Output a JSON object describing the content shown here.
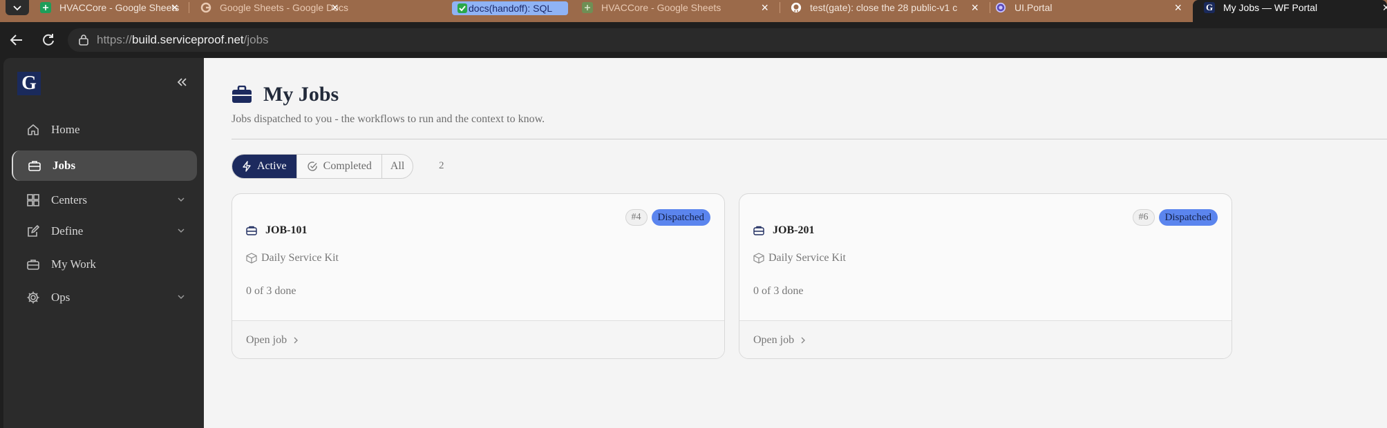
{
  "browser": {
    "tabs": [
      {
        "label": "HVACCore - Google Sheets",
        "favicon": "sheets-icon"
      },
      {
        "label": "Google Sheets - Google Docs Edit",
        "favicon": "google-icon"
      },
      {
        "label": "docs(handoff): SQL",
        "favicon": "checkmark-icon"
      },
      {
        "label": "HVACCore - Google Sheets",
        "favicon": "sheets-icon"
      },
      {
        "label": "test(gate): close the 28 public-v1 c",
        "favicon": "github-icon"
      },
      {
        "label": "UI.Portal",
        "favicon": "portal-icon"
      },
      {
        "label": "My Jobs — WF Portal",
        "favicon": "g-logo-icon"
      }
    ],
    "url": {
      "scheme": "https://",
      "host": "build.serviceproof.net",
      "path": "/jobs"
    }
  },
  "sidebar": {
    "logo_letter": "G",
    "items": [
      {
        "label": "Home",
        "icon": "home-icon"
      },
      {
        "label": "Jobs",
        "icon": "briefcase-icon",
        "active": true
      },
      {
        "label": "Centers",
        "icon": "grid-icon",
        "expandable": true
      },
      {
        "label": "Define",
        "icon": "edit-icon",
        "expandable": true
      },
      {
        "label": "My Work",
        "icon": "briefcase-icon"
      },
      {
        "label": "Ops",
        "icon": "gear-icon",
        "expandable": true
      }
    ]
  },
  "page": {
    "title": "My Jobs",
    "subtitle": "Jobs dispatched to you - the workflows to run and the context to know.",
    "filters": [
      {
        "label": "Active",
        "icon": "lightning-icon",
        "selected": true
      },
      {
        "label": "Completed",
        "icon": "check-circle-icon"
      },
      {
        "label": "All"
      }
    ],
    "count": "2"
  },
  "jobs": [
    {
      "number": "#4",
      "status": "Dispatched",
      "id": "JOB-101",
      "kit": "Daily Service Kit",
      "progress": "0 of 3 done",
      "open_label": "Open job"
    },
    {
      "number": "#6",
      "status": "Dispatched",
      "id": "JOB-201",
      "kit": "Daily Service Kit",
      "progress": "0 of 3 done",
      "open_label": "Open job"
    }
  ],
  "colors": {
    "accent": "#1c2a5e",
    "status": "#5b85ee",
    "sidebar": "#2b2b2b"
  }
}
